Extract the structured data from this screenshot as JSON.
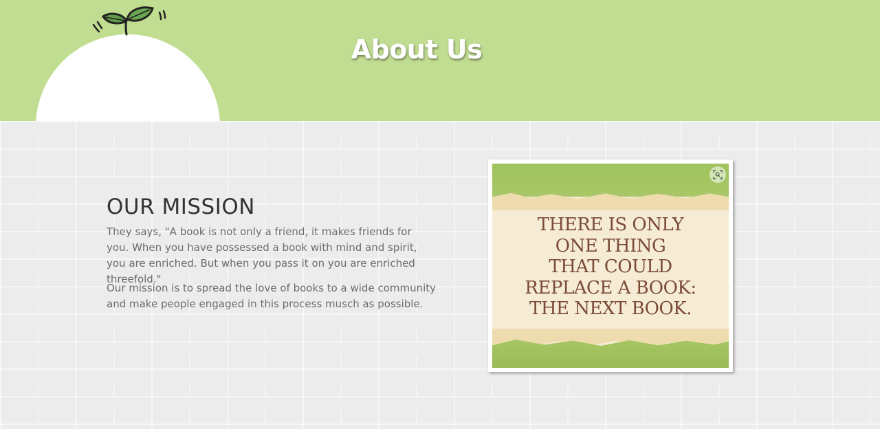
{
  "header": {
    "title": "About Us",
    "background_color": "#c1dd91",
    "logo_icon": "sprout-icon"
  },
  "mission": {
    "heading": "OUR MISSION",
    "paragraph1": "They says, \"A book is not only a friend, it makes friends for you. When you have possessed a book with mind and spirit, you are enriched. But when you pass it on you are enriched threefold.\"",
    "paragraph2": "Our mission is to spread the love of books to a wide community and make people engaged in this process musch as possible."
  },
  "quote_image": {
    "lines": [
      "THERE IS ONLY",
      "ONE THING",
      "THAT COULD",
      "REPLACE A BOOK:",
      "THE NEXT BOOK."
    ],
    "zoom_icon": "zoom-icon",
    "text_color": "#7a4a37",
    "band_color": "#a5c664"
  }
}
